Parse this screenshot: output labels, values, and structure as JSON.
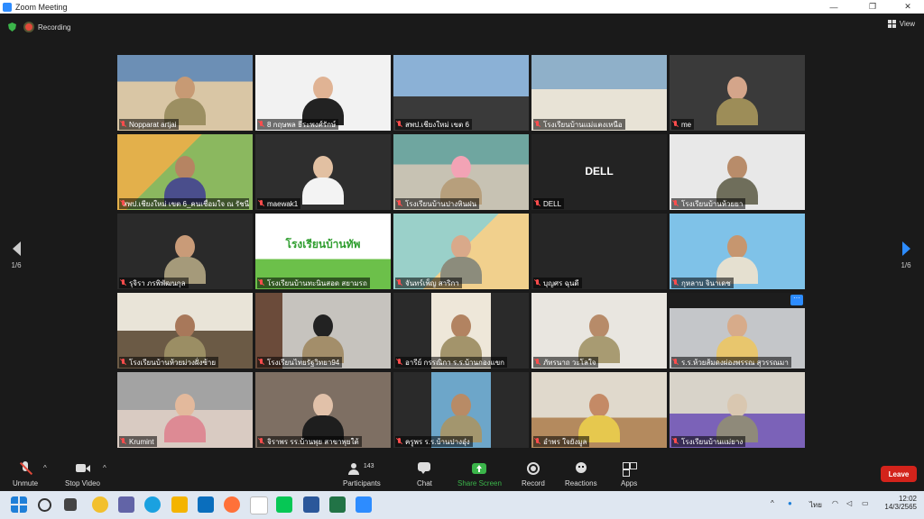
{
  "window": {
    "title": "Zoom Meeting",
    "controls": [
      "—",
      "❐",
      "✕"
    ]
  },
  "topbar": {
    "recording_label": "Recording",
    "view_label": "View"
  },
  "pager": {
    "left": "1/6",
    "right": "1/6"
  },
  "tiles": [
    {
      "name": "Nopparat artjai"
    },
    {
      "name": "8 กฤษพล ธีระพงศ์รักษ์"
    },
    {
      "name": "สพป.เชียงใหม่ เขต 6"
    },
    {
      "name": "โรงเรียนบ้านแม่แตงเหนือ"
    },
    {
      "name": "me"
    },
    {
      "name": "สพป.เชียงใหม่ เขต 6_คนเชื่อมใจ ณ รัชนี"
    },
    {
      "name": "maewak1"
    },
    {
      "name": "โรงเรียนบ้านปางหินฝน"
    },
    {
      "name": "DELL",
      "label": "DELL"
    },
    {
      "name": "โรงเรียนบ้านห้วยยา"
    },
    {
      "name": "รุจิรา ภรพิพัฒนกุล"
    },
    {
      "name": "โรงเรียนบ้านทะนินสอด สยามรถ",
      "sign": "โรงเรียนบ้านทัพ"
    },
    {
      "name": "จันทร์เพ็ญ สาริกา"
    },
    {
      "name": "บุญศร ฉุนดี"
    },
    {
      "name": "กุหลาบ จินาเดช"
    },
    {
      "name": "โรงเรียนบ้านห้วยม่วงฝั่งซ้าย"
    },
    {
      "name": "โรงเรียนไทยรัฐวิทยา94"
    },
    {
      "name": "อารีย์ กรรณิกา ร.ร.บ้านกองแขก"
    },
    {
      "name": "ภัทรนาถ วะโลใจ"
    },
    {
      "name": "ร.ร.ห้วยส้มดงผ่องพรรณ สุวรรณมา"
    },
    {
      "name": "Krumint"
    },
    {
      "name": "จิราพร รร.บ้านพุย สาขาพุยใต้"
    },
    {
      "name": "ครูพร ร.ร.บ้านปางอุ๋ง"
    },
    {
      "name": "อำพร ใจยังมูล"
    },
    {
      "name": "โรงเรียนบ้านแม่ยาง"
    }
  ],
  "toolbar": {
    "unmute": "Unmute",
    "stop_video": "Stop Video",
    "participants": "Participants",
    "participants_count": "143",
    "chat": "Chat",
    "share_screen": "Share Screen",
    "record": "Record",
    "reactions": "Reactions",
    "apps": "Apps",
    "leave": "Leave"
  },
  "taskbar": {
    "lang": "ไทย",
    "time": "12:02",
    "date": "14/3/2565"
  },
  "colors": {
    "share_green": "#3bb54a",
    "leave_red": "#d3231b",
    "active_border": "#b7e84a",
    "zoom_blue": "#2d8cff"
  }
}
